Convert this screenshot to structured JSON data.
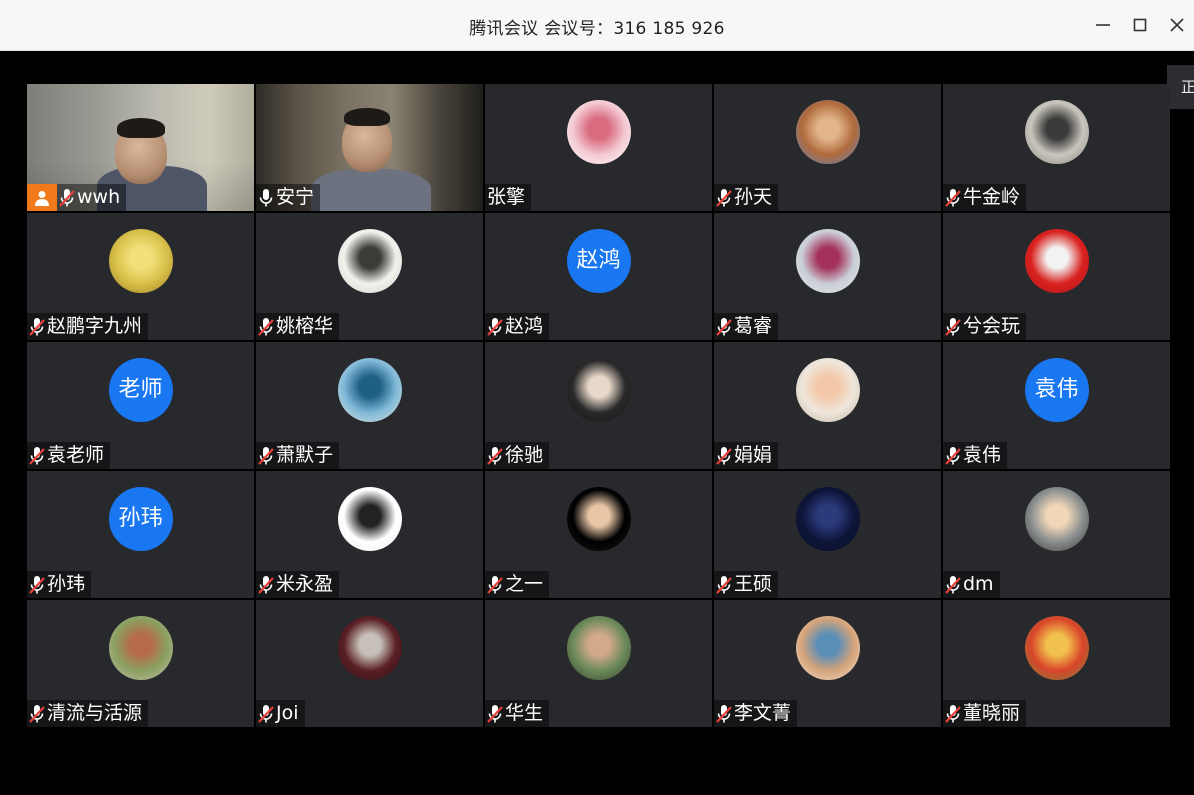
{
  "window": {
    "title": "腾讯会议 会议号：316 185 926"
  },
  "side_tab": {
    "label": "正"
  },
  "participants": [
    {
      "name": "wwh",
      "type": "video",
      "mic": "muted",
      "host": true
    },
    {
      "name": "安宁",
      "type": "video",
      "mic": "on",
      "active": true
    },
    {
      "name": "张擎",
      "type": "photo",
      "mic": "none",
      "avatar_colors": [
        "#f3c9d2",
        "#d96b7f",
        "#ffffff"
      ]
    },
    {
      "name": "孙天",
      "type": "photo",
      "mic": "muted",
      "avatar_colors": [
        "#b06a3c",
        "#e2b48a",
        "#5b87c8"
      ]
    },
    {
      "name": "牛金岭",
      "type": "photo",
      "mic": "muted",
      "avatar_colors": [
        "#c9c6bd",
        "#3a3a3a",
        "#8a857a"
      ]
    },
    {
      "name": "赵鹏字九州",
      "type": "photo",
      "mic": "muted",
      "avatar_colors": [
        "#d8c04a",
        "#f2e07a",
        "#9a7d20"
      ]
    },
    {
      "name": "姚榕华",
      "type": "photo",
      "mic": "muted",
      "avatar_colors": [
        "#f2f2ee",
        "#3a3c38",
        "#d0cfc5"
      ]
    },
    {
      "name": "赵鸿",
      "type": "text",
      "mic": "muted",
      "avatar_text": "赵鸿"
    },
    {
      "name": "葛睿",
      "type": "photo",
      "mic": "muted",
      "avatar_colors": [
        "#c9cdd4",
        "#a4315c",
        "#e9ecf0"
      ]
    },
    {
      "name": "兮会玩",
      "type": "photo",
      "mic": "muted",
      "avatar_colors": [
        "#d9221f",
        "#f2f2f2",
        "#b0121a"
      ]
    },
    {
      "name": "袁老师",
      "type": "text",
      "mic": "muted",
      "avatar_text": "老师"
    },
    {
      "name": "萧默子",
      "type": "photo",
      "mic": "muted",
      "avatar_colors": [
        "#7fb8d8",
        "#1f5f86",
        "#e3e6d9"
      ]
    },
    {
      "name": "徐驰",
      "type": "photo",
      "mic": "muted",
      "avatar_colors": [
        "#2a2a2a",
        "#e7d8c9",
        "#111111"
      ]
    },
    {
      "name": "娟娟",
      "type": "photo",
      "mic": "muted",
      "avatar_colors": [
        "#efe7dc",
        "#f3c8a8",
        "#bdb1a2"
      ]
    },
    {
      "name": "袁伟",
      "type": "text",
      "mic": "muted",
      "avatar_text": "袁伟"
    },
    {
      "name": "孙玮",
      "type": "text",
      "mic": "muted",
      "avatar_text": "孙玮"
    },
    {
      "name": "米永盈",
      "type": "photo",
      "mic": "muted",
      "avatar_colors": [
        "#ffffff",
        "#222222",
        "#f0f0f0"
      ]
    },
    {
      "name": "之一",
      "type": "photo",
      "mic": "muted",
      "avatar_colors": [
        "#000000",
        "#e8c6a6",
        "#1a1a1a"
      ]
    },
    {
      "name": "王硕",
      "type": "photo",
      "mic": "muted",
      "avatar_colors": [
        "#0e1438",
        "#2a3a7a",
        "#091028"
      ]
    },
    {
      "name": "dm",
      "type": "photo",
      "mic": "muted",
      "avatar_colors": [
        "#8a8f90",
        "#f1d7b8",
        "#3b3430"
      ]
    },
    {
      "name": "清流与活源",
      "type": "photo",
      "mic": "muted",
      "avatar_colors": [
        "#8aa060",
        "#b66b4a",
        "#c9c2b0"
      ]
    },
    {
      "name": "Joi",
      "type": "photo",
      "mic": "muted",
      "avatar_colors": [
        "#5a1f25",
        "#c7c0b8",
        "#2b1115"
      ]
    },
    {
      "name": "华生",
      "type": "photo",
      "mic": "muted",
      "avatar_colors": [
        "#6c8a5a",
        "#d2a98a",
        "#333f2a"
      ]
    },
    {
      "name": "李文菁",
      "type": "photo",
      "mic": "muted",
      "avatar_colors": [
        "#d4a37a",
        "#5a8fb8",
        "#f2e6cf"
      ]
    },
    {
      "name": "董晓丽",
      "type": "photo",
      "mic": "muted",
      "avatar_colors": [
        "#d9442a",
        "#f1c14d",
        "#6f8a3a"
      ]
    }
  ]
}
